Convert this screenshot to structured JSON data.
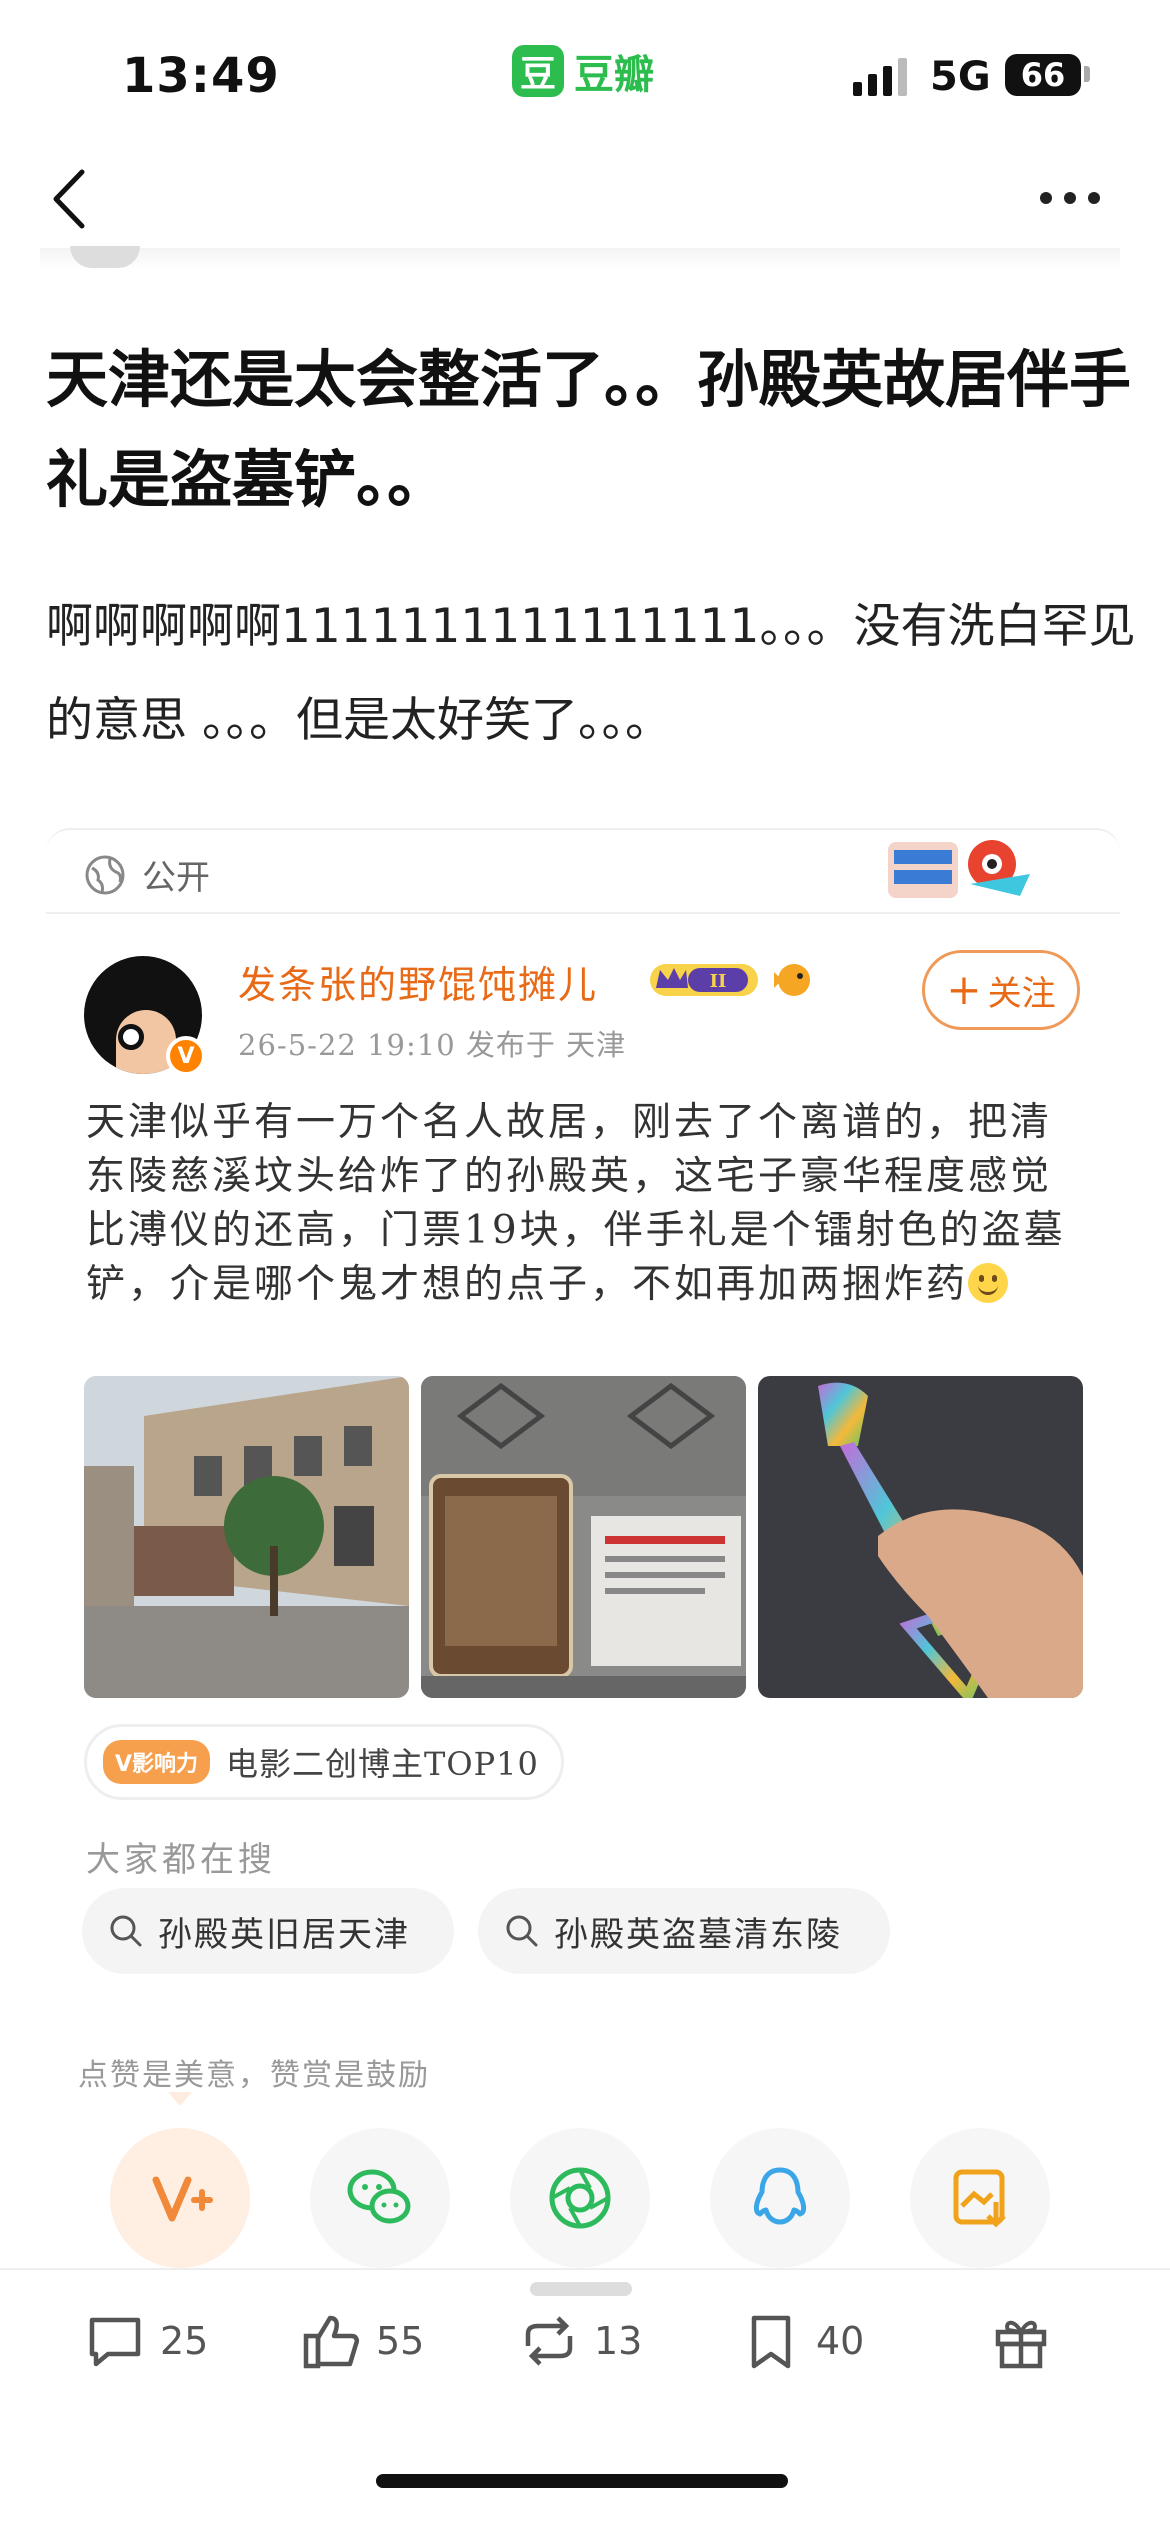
{
  "status_bar": {
    "time": "13:49",
    "app_name": "豆瓣",
    "app_icon_glyph": "豆",
    "network": "5G",
    "battery": "66"
  },
  "post": {
    "title": "天津还是太会整活了。。孙殿英故居伴手礼是盗墓铲。。",
    "body": "啊啊啊啊啊1111111111111111。。。没有洗白罕见的意思 。。。但是太好笑了。。。",
    "visibility": "公开"
  },
  "embedded": {
    "username": "发条张的野馄饨摊儿",
    "vip_level": "II",
    "meta": "26-5-22 19:10   发布于 天津",
    "follow_label": "关注",
    "text": "天津似乎有一万个名人故居，刚去了个离谱的，把清东陵慈溪坟头给炸了的孙殿英，这宅子豪华程度感觉比溥仪的还高，门票19块，伴手礼是个镭射色的盗墓铲，介是哪个鬼才想的点子，不如再加两捆炸药",
    "influence_tag": "V影响力",
    "influence_text": "电影二创博主TOP10",
    "search_heading": "大家都在搜",
    "searches": [
      "孙殿英旧居天津",
      "孙殿英盗墓清东陵"
    ]
  },
  "like_hint": "点赞是美意，赞赏是鼓励",
  "share_buttons": [
    "v-plus-icon",
    "wechat-icon",
    "moments-icon",
    "qq-icon",
    "save-image-icon"
  ],
  "actions": {
    "comments": "25",
    "likes": "55",
    "reshares": "13",
    "collects": "40"
  },
  "colors": {
    "brand_green": "#2dbd4f",
    "weibo_orange": "#e86a17"
  }
}
